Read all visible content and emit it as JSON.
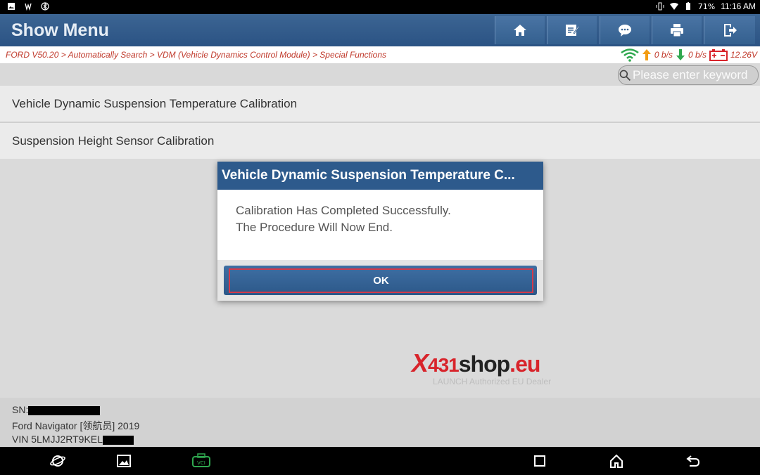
{
  "status_bar": {
    "battery": "71%",
    "time": "11:16 AM"
  },
  "header": {
    "title": "Show Menu",
    "buttons": [
      "home-icon",
      "edit-icon",
      "chat-icon",
      "print-icon",
      "exit-icon"
    ]
  },
  "breadcrumb": {
    "text": "FORD V50.20 > Automatically Search > VDM (Vehicle Dynamics Control Module) > Special Functions",
    "upload": "0 b/s",
    "download": "0 b/s",
    "voltage": "12.26V"
  },
  "search": {
    "placeholder": "Please enter keyword"
  },
  "menu": {
    "items": [
      {
        "label": "Vehicle Dynamic Suspension Temperature Calibration"
      },
      {
        "label": "Suspension Height Sensor Calibration"
      }
    ]
  },
  "dialog": {
    "title": "Vehicle Dynamic Suspension Temperature C...",
    "message_line1": "Calibration Has Completed Successfully.",
    "message_line2": "The Procedure Will Now End.",
    "ok_label": "OK"
  },
  "watermark": {
    "x": "X",
    "num": "431",
    "shop": "shop",
    "eu": ".eu",
    "sub": "LAUNCH Authorized EU Dealer"
  },
  "footer": {
    "sn_label": "SN:",
    "vehicle": "Ford Navigator [领航员] 2019",
    "vin_label": "VIN 5LMJJ2RT9KEL"
  },
  "colors": {
    "header": "#2b5384",
    "breadcrumb_text": "#c0392b",
    "ok_border": "#d43a4a",
    "wifi": "#2fa84f",
    "vci": "#2fa84f"
  }
}
